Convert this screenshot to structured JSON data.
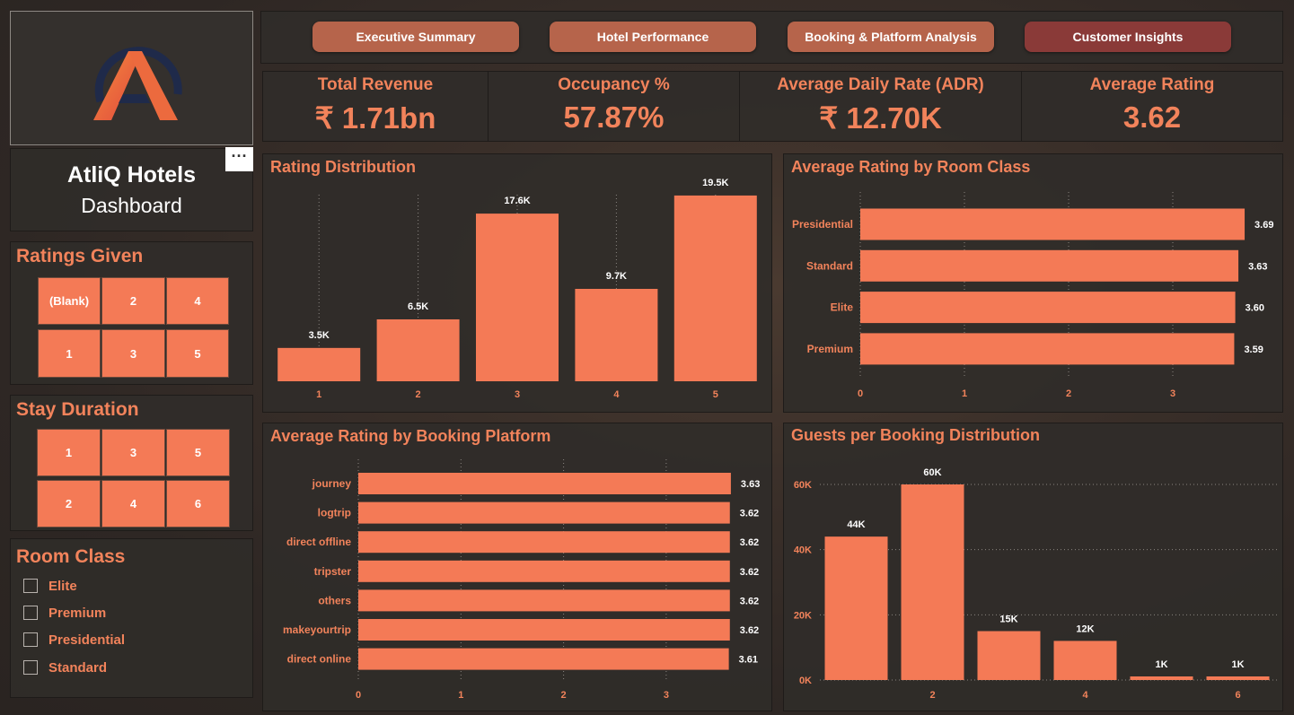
{
  "sidebar": {
    "title": "AtliQ Hotels",
    "subtitle": "Dashboard",
    "more_label": "···",
    "ratings_given": {
      "title": "Ratings Given",
      "tiles": [
        "(Blank)",
        "2",
        "4",
        "1",
        "3",
        "5"
      ]
    },
    "stay_duration": {
      "title": "Stay Duration",
      "tiles": [
        "1",
        "3",
        "5",
        "2",
        "4",
        "6"
      ]
    },
    "room_class": {
      "title": "Room Class",
      "options": [
        "Elite",
        "Premium",
        "Presidential",
        "Standard"
      ]
    }
  },
  "nav": {
    "tabs": [
      "Executive Summary",
      "Hotel Performance",
      "Booking & Platform Analysis",
      "Customer Insights"
    ],
    "active": "Customer Insights"
  },
  "kpis": [
    {
      "label": "Total Revenue",
      "value": "₹ 1.71bn"
    },
    {
      "label": "Occupancy %",
      "value": "57.87%"
    },
    {
      "label": "Average Daily Rate (ADR)",
      "value": "₹ 12.70K"
    },
    {
      "label": "Average Rating",
      "value": "3.62"
    }
  ],
  "colors": {
    "accent": "#f2835b",
    "bar": "#f47a56",
    "panel": "#302c29",
    "active_tab": "#8a3a38",
    "tab": "#b6644b"
  },
  "chart_data": [
    {
      "type": "bar",
      "title": "Rating Distribution",
      "categories": [
        "1",
        "2",
        "3",
        "4",
        "5"
      ],
      "values": [
        3.5,
        6.5,
        17.6,
        9.7,
        19.5
      ],
      "labels": [
        "3.5K",
        "6.5K",
        "17.6K",
        "9.7K",
        "19.5K"
      ],
      "ylim": [
        0,
        21
      ]
    },
    {
      "type": "bar",
      "orientation": "horizontal",
      "title": "Average Rating by Room Class",
      "categories": [
        "Presidential",
        "Standard",
        "Elite",
        "Premium"
      ],
      "values": [
        3.69,
        3.63,
        3.6,
        3.59
      ],
      "labels": [
        "3.69",
        "3.63",
        "3.60",
        "3.59"
      ],
      "xticks": [
        "0",
        "1",
        "2",
        "3"
      ],
      "xlim": [
        0,
        3.69
      ]
    },
    {
      "type": "bar",
      "orientation": "horizontal",
      "title": "Average Rating by Booking Platform",
      "categories": [
        "journey",
        "logtrip",
        "direct offline",
        "tripster",
        "others",
        "makeyourtrip",
        "direct online"
      ],
      "values": [
        3.63,
        3.62,
        3.62,
        3.62,
        3.62,
        3.62,
        3.61
      ],
      "labels": [
        "3.63",
        "3.62",
        "3.62",
        "3.62",
        "3.62",
        "3.62",
        "3.61"
      ],
      "xticks": [
        "0",
        "1",
        "2",
        "3"
      ],
      "xlim": [
        0,
        3.63
      ]
    },
    {
      "type": "bar",
      "title": "Guests per Booking Distribution",
      "categories": [
        "1",
        "2",
        "3",
        "4",
        "5",
        "6"
      ],
      "xticks": [
        "2",
        "4",
        "6"
      ],
      "values": [
        44,
        60,
        15,
        12,
        1,
        1
      ],
      "labels": [
        "44K",
        "60K",
        "15K",
        "12K",
        "1K",
        "1K"
      ],
      "yticks": [
        "0K",
        "20K",
        "40K",
        "60K"
      ],
      "ylim": [
        0,
        60
      ]
    }
  ]
}
